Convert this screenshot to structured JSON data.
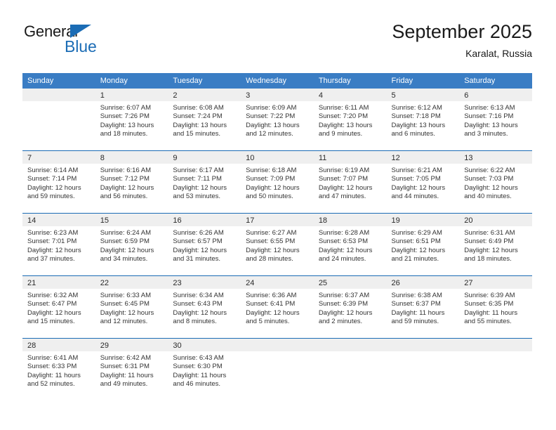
{
  "brand": {
    "word1": "General",
    "word2": "Blue",
    "triangle_color": "#1b6cb5",
    "text_color": "#1a1a1a"
  },
  "header": {
    "title": "September 2025",
    "subtitle": "Karalat, Russia"
  },
  "theme": {
    "header_bg": "#3a7dc4",
    "week_divider": "#1b6cb5",
    "daynum_bg": "#efefef",
    "text": "#333333"
  },
  "weekdays": [
    "Sunday",
    "Monday",
    "Tuesday",
    "Wednesday",
    "Thursday",
    "Friday",
    "Saturday"
  ],
  "weeks": [
    [
      {
        "day": ""
      },
      {
        "day": "1",
        "sunrise": "Sunrise: 6:07 AM",
        "sunset": "Sunset: 7:26 PM",
        "daylight1": "Daylight: 13 hours",
        "daylight2": "and 18 minutes."
      },
      {
        "day": "2",
        "sunrise": "Sunrise: 6:08 AM",
        "sunset": "Sunset: 7:24 PM",
        "daylight1": "Daylight: 13 hours",
        "daylight2": "and 15 minutes."
      },
      {
        "day": "3",
        "sunrise": "Sunrise: 6:09 AM",
        "sunset": "Sunset: 7:22 PM",
        "daylight1": "Daylight: 13 hours",
        "daylight2": "and 12 minutes."
      },
      {
        "day": "4",
        "sunrise": "Sunrise: 6:11 AM",
        "sunset": "Sunset: 7:20 PM",
        "daylight1": "Daylight: 13 hours",
        "daylight2": "and 9 minutes."
      },
      {
        "day": "5",
        "sunrise": "Sunrise: 6:12 AM",
        "sunset": "Sunset: 7:18 PM",
        "daylight1": "Daylight: 13 hours",
        "daylight2": "and 6 minutes."
      },
      {
        "day": "6",
        "sunrise": "Sunrise: 6:13 AM",
        "sunset": "Sunset: 7:16 PM",
        "daylight1": "Daylight: 13 hours",
        "daylight2": "and 3 minutes."
      }
    ],
    [
      {
        "day": "7",
        "sunrise": "Sunrise: 6:14 AM",
        "sunset": "Sunset: 7:14 PM",
        "daylight1": "Daylight: 12 hours",
        "daylight2": "and 59 minutes."
      },
      {
        "day": "8",
        "sunrise": "Sunrise: 6:16 AM",
        "sunset": "Sunset: 7:12 PM",
        "daylight1": "Daylight: 12 hours",
        "daylight2": "and 56 minutes."
      },
      {
        "day": "9",
        "sunrise": "Sunrise: 6:17 AM",
        "sunset": "Sunset: 7:11 PM",
        "daylight1": "Daylight: 12 hours",
        "daylight2": "and 53 minutes."
      },
      {
        "day": "10",
        "sunrise": "Sunrise: 6:18 AM",
        "sunset": "Sunset: 7:09 PM",
        "daylight1": "Daylight: 12 hours",
        "daylight2": "and 50 minutes."
      },
      {
        "day": "11",
        "sunrise": "Sunrise: 6:19 AM",
        "sunset": "Sunset: 7:07 PM",
        "daylight1": "Daylight: 12 hours",
        "daylight2": "and 47 minutes."
      },
      {
        "day": "12",
        "sunrise": "Sunrise: 6:21 AM",
        "sunset": "Sunset: 7:05 PM",
        "daylight1": "Daylight: 12 hours",
        "daylight2": "and 44 minutes."
      },
      {
        "day": "13",
        "sunrise": "Sunrise: 6:22 AM",
        "sunset": "Sunset: 7:03 PM",
        "daylight1": "Daylight: 12 hours",
        "daylight2": "and 40 minutes."
      }
    ],
    [
      {
        "day": "14",
        "sunrise": "Sunrise: 6:23 AM",
        "sunset": "Sunset: 7:01 PM",
        "daylight1": "Daylight: 12 hours",
        "daylight2": "and 37 minutes."
      },
      {
        "day": "15",
        "sunrise": "Sunrise: 6:24 AM",
        "sunset": "Sunset: 6:59 PM",
        "daylight1": "Daylight: 12 hours",
        "daylight2": "and 34 minutes."
      },
      {
        "day": "16",
        "sunrise": "Sunrise: 6:26 AM",
        "sunset": "Sunset: 6:57 PM",
        "daylight1": "Daylight: 12 hours",
        "daylight2": "and 31 minutes."
      },
      {
        "day": "17",
        "sunrise": "Sunrise: 6:27 AM",
        "sunset": "Sunset: 6:55 PM",
        "daylight1": "Daylight: 12 hours",
        "daylight2": "and 28 minutes."
      },
      {
        "day": "18",
        "sunrise": "Sunrise: 6:28 AM",
        "sunset": "Sunset: 6:53 PM",
        "daylight1": "Daylight: 12 hours",
        "daylight2": "and 24 minutes."
      },
      {
        "day": "19",
        "sunrise": "Sunrise: 6:29 AM",
        "sunset": "Sunset: 6:51 PM",
        "daylight1": "Daylight: 12 hours",
        "daylight2": "and 21 minutes."
      },
      {
        "day": "20",
        "sunrise": "Sunrise: 6:31 AM",
        "sunset": "Sunset: 6:49 PM",
        "daylight1": "Daylight: 12 hours",
        "daylight2": "and 18 minutes."
      }
    ],
    [
      {
        "day": "21",
        "sunrise": "Sunrise: 6:32 AM",
        "sunset": "Sunset: 6:47 PM",
        "daylight1": "Daylight: 12 hours",
        "daylight2": "and 15 minutes."
      },
      {
        "day": "22",
        "sunrise": "Sunrise: 6:33 AM",
        "sunset": "Sunset: 6:45 PM",
        "daylight1": "Daylight: 12 hours",
        "daylight2": "and 12 minutes."
      },
      {
        "day": "23",
        "sunrise": "Sunrise: 6:34 AM",
        "sunset": "Sunset: 6:43 PM",
        "daylight1": "Daylight: 12 hours",
        "daylight2": "and 8 minutes."
      },
      {
        "day": "24",
        "sunrise": "Sunrise: 6:36 AM",
        "sunset": "Sunset: 6:41 PM",
        "daylight1": "Daylight: 12 hours",
        "daylight2": "and 5 minutes."
      },
      {
        "day": "25",
        "sunrise": "Sunrise: 6:37 AM",
        "sunset": "Sunset: 6:39 PM",
        "daylight1": "Daylight: 12 hours",
        "daylight2": "and 2 minutes."
      },
      {
        "day": "26",
        "sunrise": "Sunrise: 6:38 AM",
        "sunset": "Sunset: 6:37 PM",
        "daylight1": "Daylight: 11 hours",
        "daylight2": "and 59 minutes."
      },
      {
        "day": "27",
        "sunrise": "Sunrise: 6:39 AM",
        "sunset": "Sunset: 6:35 PM",
        "daylight1": "Daylight: 11 hours",
        "daylight2": "and 55 minutes."
      }
    ],
    [
      {
        "day": "28",
        "sunrise": "Sunrise: 6:41 AM",
        "sunset": "Sunset: 6:33 PM",
        "daylight1": "Daylight: 11 hours",
        "daylight2": "and 52 minutes."
      },
      {
        "day": "29",
        "sunrise": "Sunrise: 6:42 AM",
        "sunset": "Sunset: 6:31 PM",
        "daylight1": "Daylight: 11 hours",
        "daylight2": "and 49 minutes."
      },
      {
        "day": "30",
        "sunrise": "Sunrise: 6:43 AM",
        "sunset": "Sunset: 6:30 PM",
        "daylight1": "Daylight: 11 hours",
        "daylight2": "and 46 minutes."
      },
      {
        "day": ""
      },
      {
        "day": ""
      },
      {
        "day": ""
      },
      {
        "day": ""
      }
    ]
  ]
}
